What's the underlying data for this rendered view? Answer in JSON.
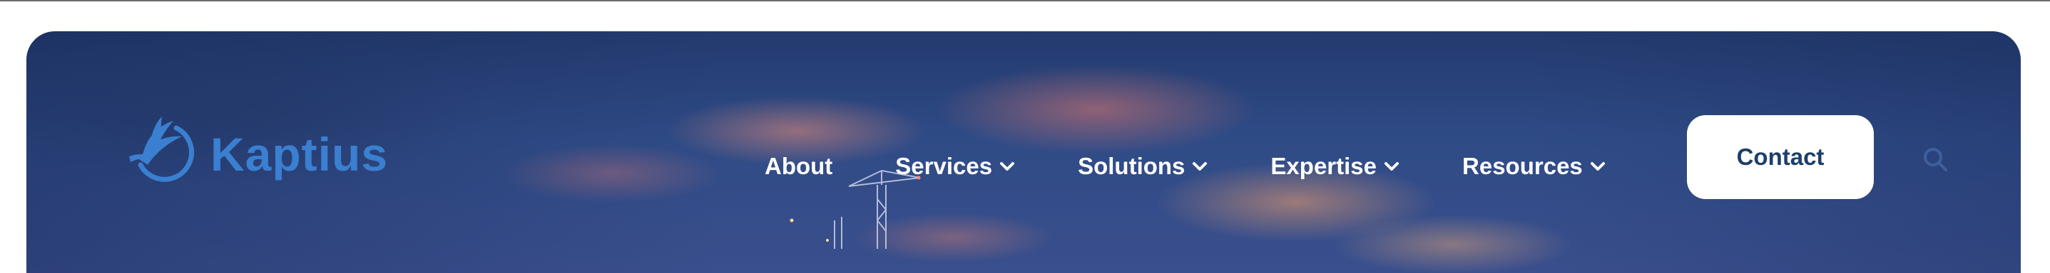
{
  "brand": {
    "name": "Kaptius",
    "logo_color": "#3a7fd0"
  },
  "nav": {
    "items": [
      {
        "label": "About",
        "has_dropdown": false
      },
      {
        "label": "Services",
        "has_dropdown": true
      },
      {
        "label": "Solutions",
        "has_dropdown": true
      },
      {
        "label": "Expertise",
        "has_dropdown": true
      },
      {
        "label": "Resources",
        "has_dropdown": true
      }
    ],
    "contact_label": "Contact",
    "contact_text_color": "#1c3f6b",
    "search_icon": "search-icon",
    "dropdown_icon": "chevron-down-icon"
  },
  "hero": {
    "background": "dusk sky with construction crane"
  }
}
